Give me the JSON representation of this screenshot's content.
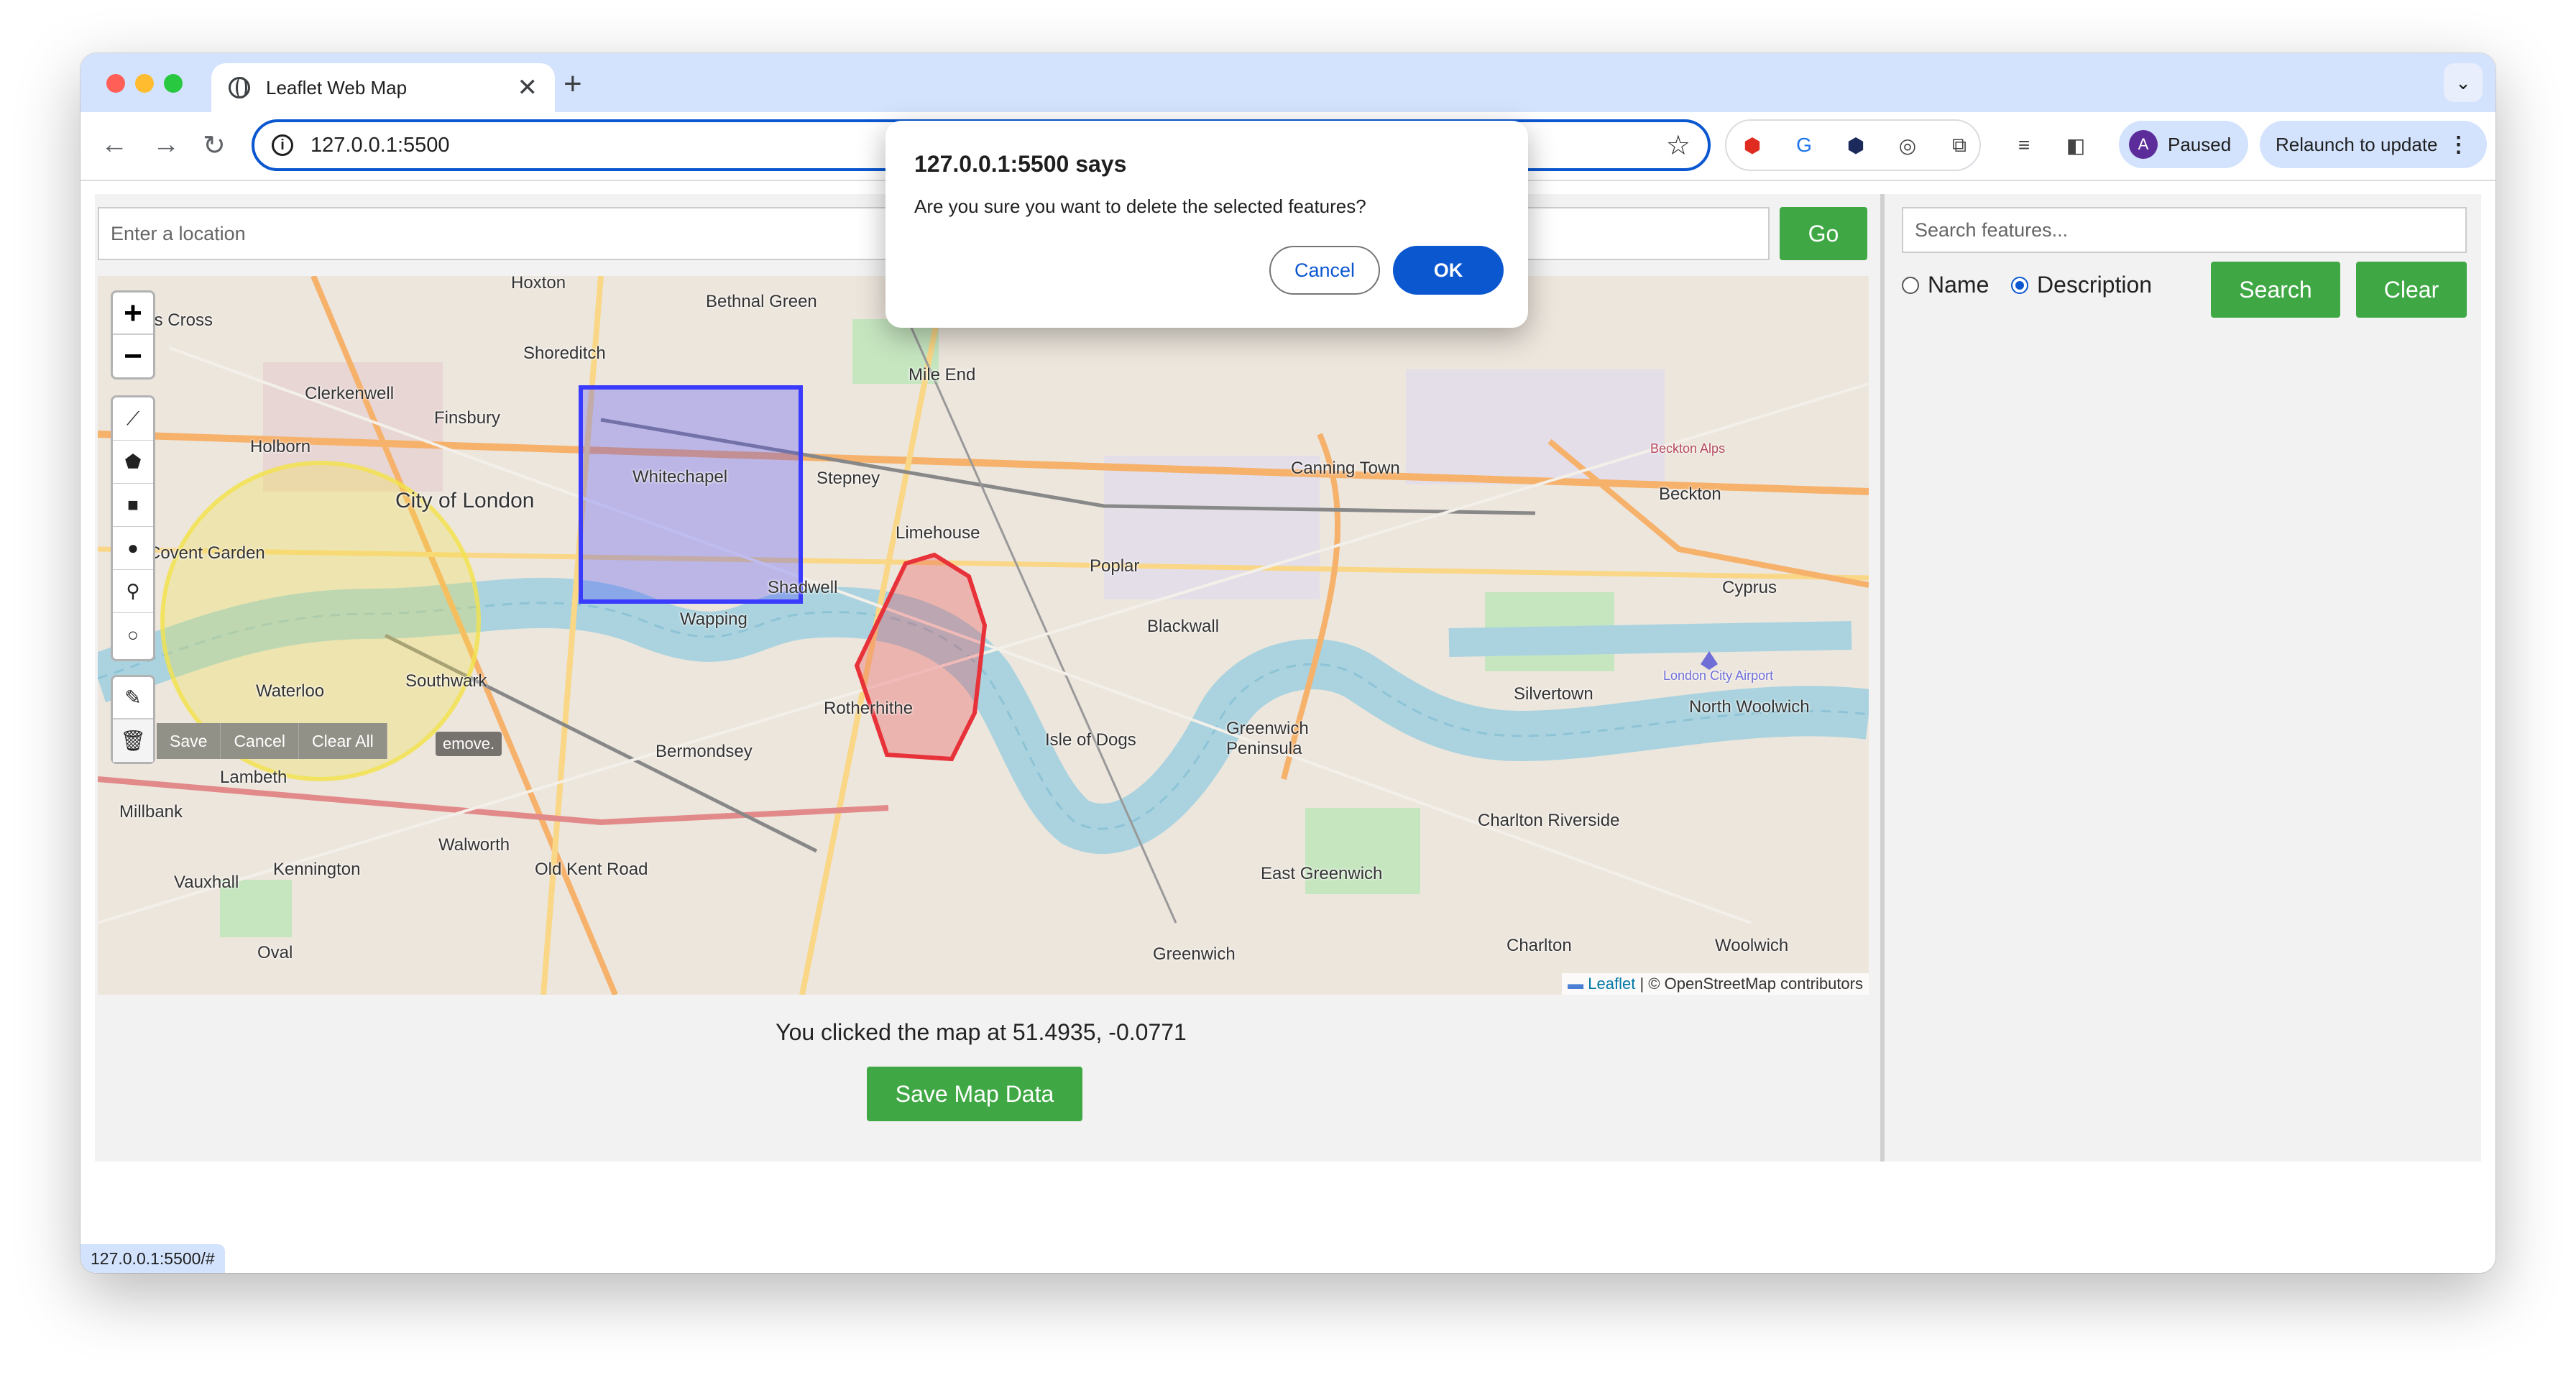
{
  "browser": {
    "tab_title": "Leaflet Web Map",
    "tab_close": "✕",
    "new_tab": "+",
    "tab_menu": "⌄",
    "url": "127.0.0.1:5500",
    "profile_initial": "A",
    "profile_label": "Paused",
    "relaunch_label": "Relaunch to update",
    "status_url": "127.0.0.1:5500/#"
  },
  "app": {
    "location_placeholder": "Enter a location",
    "go_label": "Go",
    "map": {
      "zoom_in": "+",
      "zoom_out": "−",
      "draw_actions": [
        "Save",
        "Cancel",
        "Clear All"
      ],
      "tooltip_tail": "emove.",
      "attribution_leaflet": "Leaflet",
      "attribution_rest": "| © OpenStreetMap contributors",
      "place_labels": [
        "Hoxton",
        "Bethnal Green",
        "King's Cross",
        "Shoreditch",
        "Mile End",
        "Clerkenwell",
        "Finsbury",
        "Whitechapel",
        "Stepney",
        "Holborn",
        "City of London",
        "Limehouse",
        "Covent Garden",
        "Shadwell",
        "Wapping",
        "Poplar",
        "Blackwall",
        "Canning Town",
        "Beckton",
        "Cyprus",
        "Silvertown",
        "North Woolwich",
        "Southwark",
        "Waterloo",
        "Rotherhithe",
        "Bermondsey",
        "Isle of Dogs",
        "Greenwich Peninsula",
        "Lambeth",
        "Walworth",
        "Kennington",
        "Old Kent Road",
        "East Greenwich",
        "Charlton Riverside",
        "Vauxhall",
        "Greenwich",
        "Charlton",
        "Woolwich",
        "Oval",
        "Millbank",
        "Beckton Alps",
        "London City Airport"
      ]
    },
    "clicked_message": "You clicked the map at 51.4935, -0.0771",
    "save_map_label": "Save Map Data"
  },
  "sidebar": {
    "search_placeholder": "Search features...",
    "radio_name": "Name",
    "radio_description": "Description",
    "radio_selected": "Description",
    "search_label": "Search",
    "clear_label": "Clear"
  },
  "dialog": {
    "title": "127.0.0.1:5500 says",
    "message": "Are you sure you want to delete the selected features?",
    "cancel_label": "Cancel",
    "ok_label": "OK"
  },
  "colors": {
    "accent_green": "#3fa845",
    "chrome_blue": "#0b57d0",
    "rectangle_feature": "#3b3bff",
    "polygon_feature": "#e8323a",
    "circle_feature": "#f2e24a"
  }
}
